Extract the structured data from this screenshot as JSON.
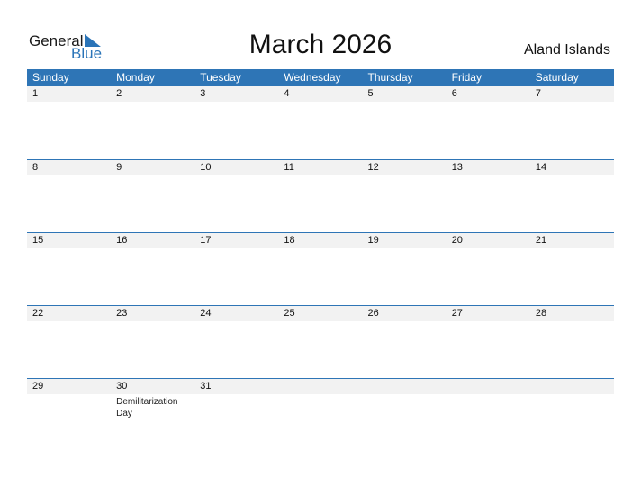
{
  "logo": {
    "general": "General",
    "blue": "Blue"
  },
  "title": "March 2026",
  "country": "Aland Islands",
  "weekdays": [
    "Sunday",
    "Monday",
    "Tuesday",
    "Wednesday",
    "Thursday",
    "Friday",
    "Saturday"
  ],
  "weeks": [
    [
      {
        "d": "1"
      },
      {
        "d": "2"
      },
      {
        "d": "3"
      },
      {
        "d": "4"
      },
      {
        "d": "5"
      },
      {
        "d": "6"
      },
      {
        "d": "7"
      }
    ],
    [
      {
        "d": "8"
      },
      {
        "d": "9"
      },
      {
        "d": "10"
      },
      {
        "d": "11"
      },
      {
        "d": "12"
      },
      {
        "d": "13"
      },
      {
        "d": "14"
      }
    ],
    [
      {
        "d": "15"
      },
      {
        "d": "16"
      },
      {
        "d": "17"
      },
      {
        "d": "18"
      },
      {
        "d": "19"
      },
      {
        "d": "20"
      },
      {
        "d": "21"
      }
    ],
    [
      {
        "d": "22"
      },
      {
        "d": "23"
      },
      {
        "d": "24"
      },
      {
        "d": "25"
      },
      {
        "d": "26"
      },
      {
        "d": "27"
      },
      {
        "d": "28"
      }
    ],
    [
      {
        "d": "29"
      },
      {
        "d": "30",
        "e": "Demilitarization Day"
      },
      {
        "d": "31"
      },
      {
        "d": ""
      },
      {
        "d": ""
      },
      {
        "d": ""
      },
      {
        "d": ""
      }
    ]
  ]
}
